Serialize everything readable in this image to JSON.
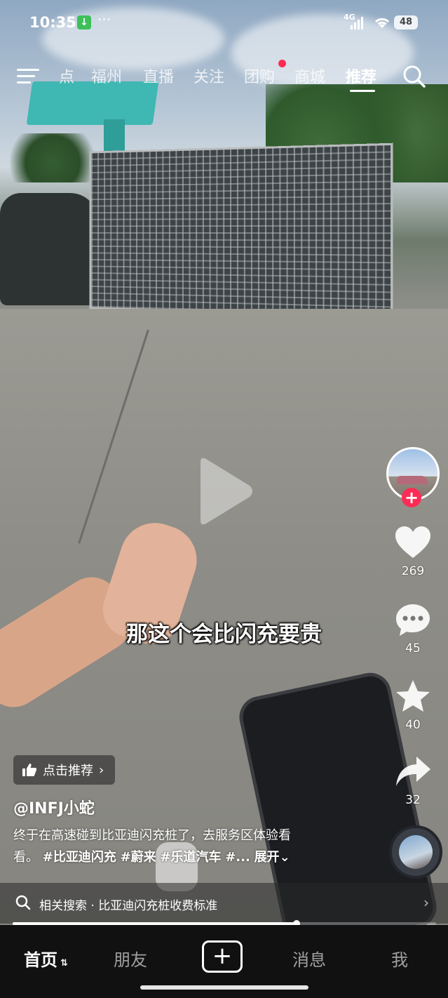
{
  "status_bar": {
    "time": "10:35",
    "download_icon": "↓",
    "more": "···",
    "network": "4G",
    "battery": "48"
  },
  "top_nav": {
    "tabs": [
      {
        "label": "点"
      },
      {
        "label": "福州"
      },
      {
        "label": "直播"
      },
      {
        "label": "关注"
      },
      {
        "label": "团购"
      },
      {
        "label": "商城"
      },
      {
        "label": "推荐"
      }
    ],
    "active_tab": "推荐"
  },
  "video": {
    "subtitle": "那这个会比闪充要贵",
    "progress_fraction": 0.67
  },
  "actions": {
    "likes": "269",
    "comments": "45",
    "favorites": "40",
    "shares": "32"
  },
  "post": {
    "recommend_label": "点击推荐",
    "author": "@INFJ小蛇",
    "description_line1": "终于在高速碰到比亚迪闪充桩了，去服务区体验看",
    "description_line2_prefix": "看。",
    "hashtags": [
      "#比亚迪闪充",
      "#蔚来",
      "#乐道汽车",
      "#..."
    ],
    "expand_label": "展开"
  },
  "related_search": {
    "prefix": "相关搜索",
    "separator": "·",
    "query": "比亚迪闪充桩收费标准"
  },
  "bottom_nav": {
    "home": "首页",
    "friends": "朋友",
    "messages": "消息",
    "me": "我"
  },
  "colors": {
    "accent": "#fe2c55",
    "bottom_bg": "#111111"
  }
}
